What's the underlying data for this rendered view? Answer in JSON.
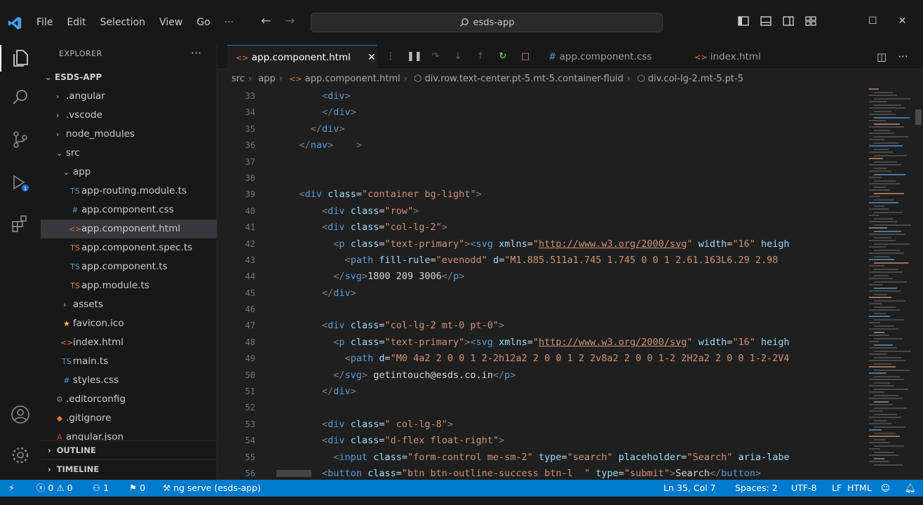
{
  "titlebar": {
    "menu": [
      "File",
      "Edit",
      "Selection",
      "View",
      "Go",
      "···"
    ],
    "search_text": "esds-app"
  },
  "sidebar": {
    "title": "EXPLORER",
    "more": "···",
    "items": [
      {
        "label": "ESDS-APP",
        "kind": "root"
      },
      {
        "label": ".angular",
        "kind": "folder"
      },
      {
        "label": ".vscode",
        "kind": "folder"
      },
      {
        "label": "node_modules",
        "kind": "folder"
      },
      {
        "label": "src",
        "kind": "folder-open"
      },
      {
        "label": "app",
        "kind": "folder-open"
      },
      {
        "label": "app-routing.module.ts",
        "kind": "ts"
      },
      {
        "label": "app.component.css",
        "kind": "css"
      },
      {
        "label": "app.component.html",
        "kind": "html"
      },
      {
        "label": "app.component.spec.ts",
        "kind": "ts"
      },
      {
        "label": "app.component.ts",
        "kind": "ts"
      },
      {
        "label": "app.module.ts",
        "kind": "ts"
      },
      {
        "label": "assets",
        "kind": "folder"
      },
      {
        "label": "favicon.ico",
        "kind": "ico"
      },
      {
        "label": "index.html",
        "kind": "html"
      },
      {
        "label": "main.ts",
        "kind": "ts"
      },
      {
        "label": "styles.css",
        "kind": "css"
      },
      {
        "label": ".editorconfig",
        "kind": "config"
      },
      {
        "label": ".gitignore",
        "kind": "git"
      },
      {
        "label": "angular.json",
        "kind": "json"
      }
    ],
    "outline": "OUTLINE",
    "timeline": "TIMELINE"
  },
  "editor": {
    "tabs": [
      {
        "label": "app.component.html",
        "active": true
      },
      {
        "label": "app.component.css",
        "active": false
      },
      {
        "label": "index.html",
        "active": false
      }
    ],
    "breadcrumb": [
      "src",
      "app",
      "app.component.html",
      "div.row.text-center.pt-5.mt-5.container-fluid",
      "div.col-lg-2.mt-5.pt-5"
    ],
    "lines": [
      {
        "n": "33",
        "indent": "        ",
        "html": "<span class='tg'>&lt;</span><span class='tn'>div</span><span class='tg'>&gt;</span>"
      },
      {
        "n": "34",
        "indent": "        ",
        "html": "<span class='tg'>&lt;/</span><span class='tn'>div</span><span class='tg'>&gt;</span>"
      },
      {
        "n": "35",
        "indent": "      ",
        "html": "<span class='tg'>&lt;/</span><span class='tn'>div</span><span class='tg'>&gt;</span>"
      },
      {
        "n": "36",
        "indent": "    ",
        "html": "<span class='tg'>&lt;/</span><span class='tn'>nav</span><span class='tg'>&gt;</span>    <span class='tg'>&gt;</span>"
      },
      {
        "n": "37",
        "indent": "",
        "html": ""
      },
      {
        "n": "38",
        "indent": "",
        "html": ""
      },
      {
        "n": "39",
        "indent": "    ",
        "html": "<span class='tg'>&lt;</span><span class='tn'>div</span> <span class='at'>class</span>=<span class='st'>\"container bg-light\"</span><span class='tg'>&gt;</span>"
      },
      {
        "n": "40",
        "indent": "        ",
        "html": "<span class='tg'>&lt;</span><span class='tn'>div</span> <span class='at'>class</span>=<span class='st'>\"row\"</span><span class='tg'>&gt;</span>"
      },
      {
        "n": "41",
        "indent": "        ",
        "html": "<span class='tg'>&lt;</span><span class='tn'>div</span> <span class='at'>class</span>=<span class='st'>\"col-lg-2\"</span><span class='tg'>&gt;</span>"
      },
      {
        "n": "42",
        "indent": "          ",
        "html": "<span class='tg'>&lt;</span><span class='tn'>p</span> <span class='at'>class</span>=<span class='st'>\"text-primary\"</span><span class='tg'>&gt;&lt;</span><span class='tn'>svg</span> <span class='at'>xmlns</span>=<span class='st'>\"</span><span class='url'>http://www.w3.org/2000/svg</span><span class='st'>\"</span> <span class='at'>width</span>=<span class='st'>\"16\"</span> <span class='at'>heigh</span>"
      },
      {
        "n": "43",
        "indent": "            ",
        "html": "<span class='tg'>&lt;</span><span class='tn'>path</span> <span class='at'>fill-rule</span>=<span class='st'>\"evenodd\"</span> <span class='at'>d</span>=<span class='st'>\"M1.885.511a1.745 1.745 0 0 1 2.61.163L6.29 2.98</span>"
      },
      {
        "n": "44",
        "indent": "          ",
        "html": "<span class='tg'>&lt;/</span><span class='tn'>svg</span><span class='tg'>&gt;</span><span class='tx'>1800 209 3006</span><span class='tg'>&lt;/</span><span class='tn'>p</span><span class='tg'>&gt;</span>"
      },
      {
        "n": "45",
        "indent": "        ",
        "html": "<span class='tg'>&lt;/</span><span class='tn'>div</span><span class='tg'>&gt;</span>"
      },
      {
        "n": "46",
        "indent": "",
        "html": ""
      },
      {
        "n": "47",
        "indent": "        ",
        "html": "<span class='tg'>&lt;</span><span class='tn'>div</span> <span class='at'>class</span>=<span class='st'>\"col-lg-2 mt-0 pt-0\"</span><span class='tg'>&gt;</span>"
      },
      {
        "n": "48",
        "indent": "          ",
        "html": "<span class='tg'>&lt;</span><span class='tn'>p</span> <span class='at'>class</span>=<span class='st'>\"text-primary\"</span><span class='tg'>&gt;&lt;</span><span class='tn'>svg</span> <span class='at'>xmlns</span>=<span class='st'>\"</span><span class='url'>http://www.w3.org/2000/svg</span><span class='st'>\"</span> <span class='at'>width</span>=<span class='st'>\"16\"</span> <span class='at'>heigh</span>"
      },
      {
        "n": "49",
        "indent": "            ",
        "html": "<span class='tg'>&lt;</span><span class='tn'>path</span> <span class='at'>d</span>=<span class='st'>\"M0 4a2 2 0 0 1 2-2h12a2 2 0 0 1 2 2v8a2 2 0 0 1-2 2H2a2 2 0 0 1-2-2V4</span>"
      },
      {
        "n": "50",
        "indent": "          ",
        "html": "<span class='tg'>&lt;/</span><span class='tn'>svg</span><span class='tg'>&gt;</span> <span class='tx'>getintouch@esds.co.in</span><span class='tg'>&lt;/</span><span class='tn'>p</span><span class='tg'>&gt;</span>"
      },
      {
        "n": "51",
        "indent": "        ",
        "html": "<span class='tg'>&lt;/</span><span class='tn'>div</span><span class='tg'>&gt;</span>"
      },
      {
        "n": "52",
        "indent": "",
        "html": ""
      },
      {
        "n": "53",
        "indent": "        ",
        "html": "<span class='tg'>&lt;</span><span class='tn'>div</span> <span class='at'>class</span>=<span class='st'>\" col-lg-8\"</span><span class='tg'>&gt;</span>"
      },
      {
        "n": "54",
        "indent": "        ",
        "html": "<span class='tg'>&lt;</span><span class='tn'>div</span> <span class='at'>class</span>=<span class='st'>\"d-flex float-right\"</span><span class='tg'>&gt;</span>"
      },
      {
        "n": "55",
        "indent": "          ",
        "html": "<span class='tg'>&lt;</span><span class='tn'>input</span> <span class='at'>class</span>=<span class='st'>\"form-control me-sm-2\"</span> <span class='at'>type</span>=<span class='st'>\"search\"</span> <span class='at'>placeholder</span>=<span class='st'>\"Search\"</span> <span class='at'>aria-labe</span>"
      },
      {
        "n": "56",
        "indent": "        ",
        "html": "<span class='tg'>&lt;</span><span class='tn'>button</span> <span class='at'>class</span>=<span class='st'>\"btn btn-outline-success btn-l  \"</span> <span class='at'>type</span>=<span class='st'>\"submit\"</span><span class='tg'>&gt;</span><span class='tx'>Search</span><span class='tg'>&lt;/</span><span class='tn'>button</span><span class='tg'>&gt;</span>"
      }
    ]
  },
  "status": {
    "remote": "⚡",
    "errors": "0",
    "warnings": "0",
    "ports": "1",
    "info": "0",
    "task": "ng serve (esds-app)",
    "position": "Ln 35, Col 7",
    "spaces": "Spaces: 2",
    "encoding": "UTF-8",
    "eol": "LF",
    "language": "HTML"
  }
}
